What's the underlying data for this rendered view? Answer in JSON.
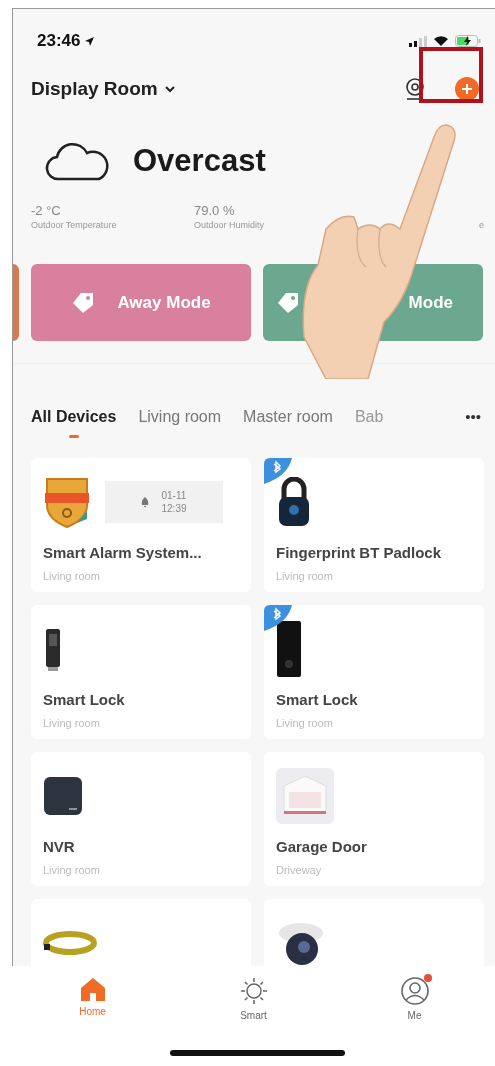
{
  "status_bar": {
    "time": "23:46"
  },
  "header": {
    "home": "Display Room"
  },
  "weather": {
    "condition": "Overcast",
    "stats": [
      {
        "value": "-2 °C",
        "label": "Outdoor Temperature"
      },
      {
        "value": "79.0 %",
        "label": "Outdoor Humidity"
      },
      {
        "label": "e"
      }
    ]
  },
  "modes": [
    {
      "label": "Away Mode",
      "color": "#d9809f"
    },
    {
      "label": "Mode",
      "color": "#6ba88f"
    }
  ],
  "tabs": [
    {
      "label": "All Devices",
      "selected": true
    },
    {
      "label": "Living room",
      "selected": false
    },
    {
      "label": "Master room",
      "selected": false
    },
    {
      "label": "Bab",
      "selected": false
    }
  ],
  "tabs_more": "•••",
  "devices": [
    {
      "kind": "alarm",
      "bluetooth": false,
      "name": "Smart Alarm System...",
      "room": "Living room",
      "status": {
        "date": "01-11",
        "time": "12:39"
      }
    },
    {
      "kind": "padlock",
      "bluetooth": true,
      "name": "Fingerprint BT Padlock",
      "room": "Living room"
    },
    {
      "kind": "lock",
      "bluetooth": false,
      "name": "Smart Lock",
      "room": "Living room"
    },
    {
      "kind": "lock_tall",
      "bluetooth": true,
      "name": "Smart Lock",
      "room": "Living room"
    },
    {
      "kind": "nvr",
      "bluetooth": false,
      "name": "NVR",
      "room": "Living room"
    },
    {
      "kind": "garage",
      "bluetooth": false,
      "name": "Garage Door",
      "room": "Driveway"
    },
    {
      "kind": "cable",
      "bluetooth": false
    },
    {
      "kind": "camera",
      "bluetooth": false
    }
  ],
  "nav": [
    {
      "label": "Home",
      "kind": "home",
      "selected": true,
      "badge": false
    },
    {
      "label": "Smart",
      "kind": "smart",
      "selected": false,
      "badge": false
    },
    {
      "label": "Me",
      "kind": "me",
      "selected": false,
      "badge": true
    }
  ]
}
